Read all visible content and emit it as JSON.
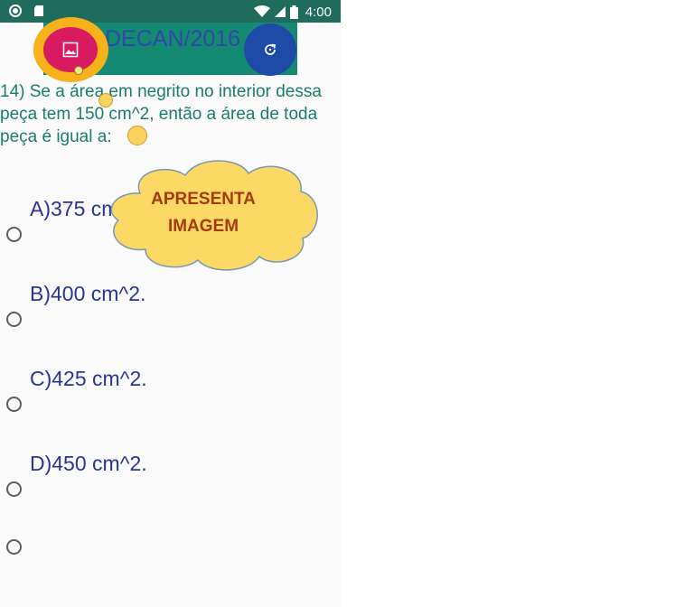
{
  "status_bar": {
    "time": "4:00",
    "icons": [
      "circle-icon",
      "sd-card-icon",
      "wifi-icon",
      "signal-icon",
      "battery-icon"
    ]
  },
  "toolbar": {
    "title": "DECAN/2016"
  },
  "question": {
    "text": "14) Se a área em negrito no interior dessa peça tem 150 cm^2, então a área de toda peça é igual a:"
  },
  "options": [
    {
      "label": "A)375 cm^2."
    },
    {
      "label": "B)400 cm^2."
    },
    {
      "label": "C)425 cm^2."
    },
    {
      "label": "D)450 cm^2."
    }
  ],
  "annotation": {
    "line1": "APRESENTA",
    "line2": "IMAGEM"
  },
  "colors": {
    "status_bar": "#1f6b5c",
    "toolbar": "#148a72",
    "image_fab": "#d81b60",
    "refresh_fab": "#1e4aa8",
    "highlight": "#f6b11b",
    "option_text": "#283593",
    "question_text": "#1a7d6c"
  }
}
